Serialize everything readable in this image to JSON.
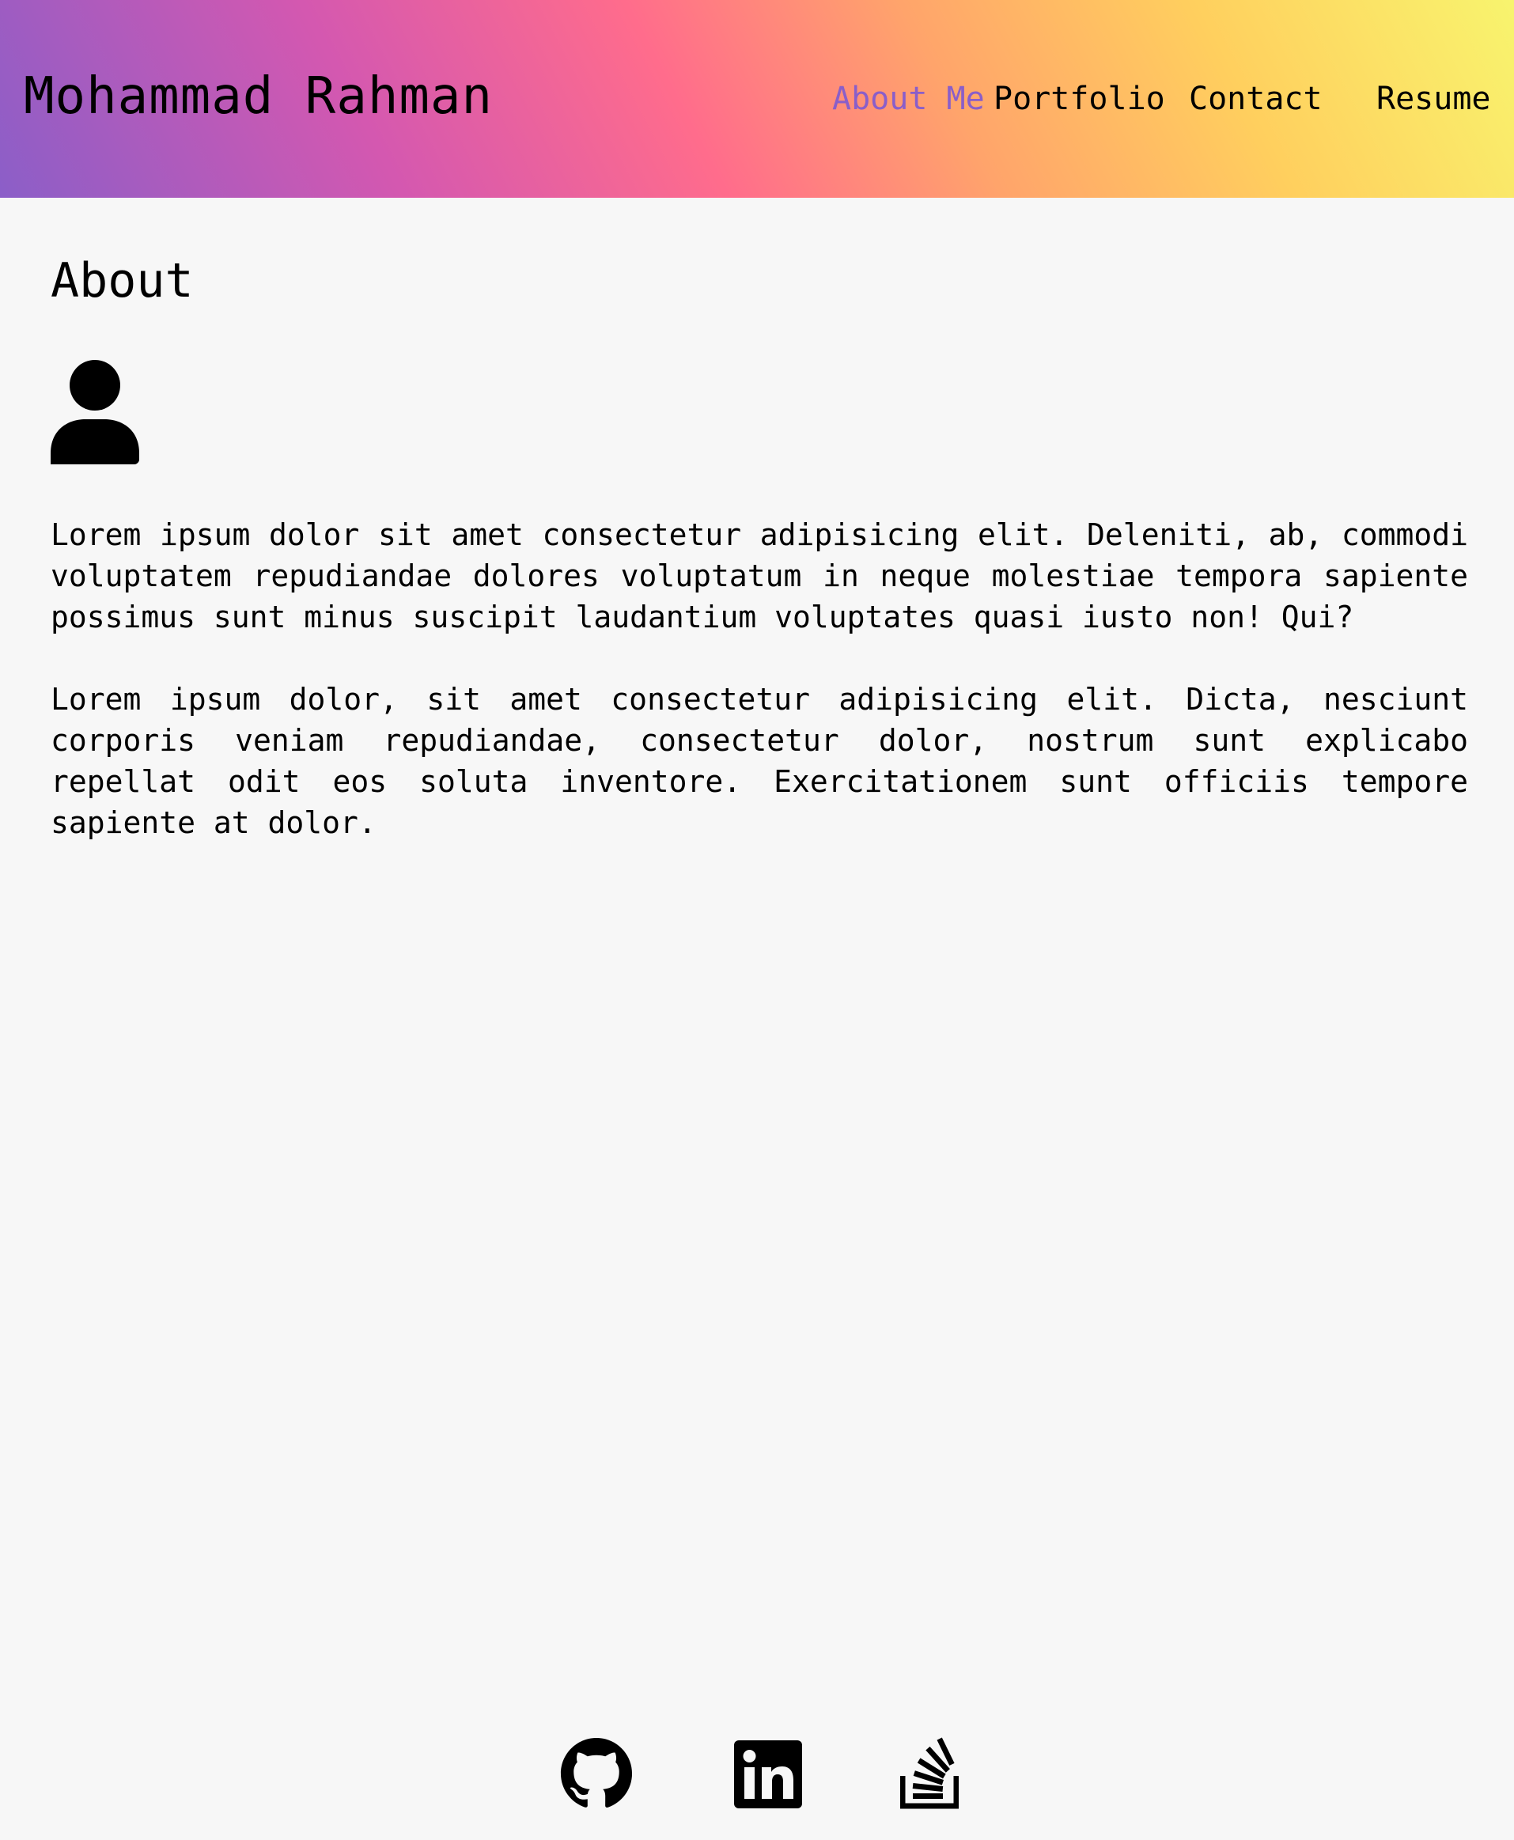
{
  "header": {
    "title": "Mohammad Rahman",
    "nav": [
      {
        "label": "About Me",
        "active": true
      },
      {
        "label": "Portfolio",
        "active": false
      },
      {
        "label": "Contact",
        "active": false
      },
      {
        "label": "Resume",
        "active": false
      }
    ],
    "gradient": [
      "#8b5ec8",
      "#d458b0",
      "#ff6c8c",
      "#ffa46b",
      "#ffcf5e",
      "#f8f46e"
    ],
    "active_nav_color": "#8a5ec9"
  },
  "main": {
    "heading": "About",
    "avatar_icon": "user-icon",
    "paragraphs": [
      "Lorem ipsum dolor sit amet consectetur adipisicing elit. Deleniti, ab, commodi voluptatem repudiandae dolores voluptatum in neque molestiae tempora sapiente possimus sunt minus suscipit laudantium voluptates quasi iusto non! Qui?",
      "Lorem ipsum dolor, sit amet consectetur adipisicing elit. Dicta, nesciunt corporis veniam repudiandae, consectetur dolor, nostrum sunt explicabo repellat odit eos soluta inventore. Exercitationem sunt officiis tempore sapiente at dolor."
    ]
  },
  "footer": {
    "social": [
      {
        "icon": "github-icon"
      },
      {
        "icon": "linkedin-icon"
      },
      {
        "icon": "stack-overflow-icon"
      }
    ]
  },
  "colors": {
    "page_background": "#f7f7f7",
    "text": "#000000"
  }
}
